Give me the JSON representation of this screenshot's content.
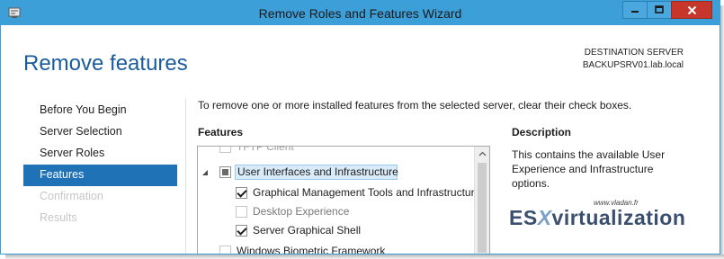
{
  "window": {
    "title": "Remove Roles and Features Wizard"
  },
  "header": {
    "title": "Remove features",
    "destination_label": "DESTINATION SERVER",
    "destination_server": "BACKUPSRV01.lab.local"
  },
  "nav": {
    "items": [
      {
        "label": "Before You Begin",
        "state": "normal"
      },
      {
        "label": "Server Selection",
        "state": "normal"
      },
      {
        "label": "Server Roles",
        "state": "normal"
      },
      {
        "label": "Features",
        "state": "active"
      },
      {
        "label": "Confirmation",
        "state": "disabled"
      },
      {
        "label": "Results",
        "state": "disabled"
      }
    ]
  },
  "main": {
    "intro": "To remove one or more installed features from the selected server, clear their check boxes.",
    "features_heading": "Features",
    "description_heading": "Description",
    "description_text": "This contains the available User Experience and Infrastructure options.",
    "tree": [
      {
        "label": "TFTP Client",
        "checked": false,
        "indent": 1
      },
      {
        "label": "User Interfaces and Infrastructure",
        "checked": "partial",
        "expanded": true,
        "selected": true,
        "indent": 0
      },
      {
        "label": "Graphical Management Tools and Infrastructure",
        "checked": true,
        "indent": 2
      },
      {
        "label": "Desktop Experience",
        "checked": false,
        "indent": 2
      },
      {
        "label": "Server Graphical Shell",
        "checked": true,
        "indent": 2
      },
      {
        "label": "Windows Biometric Framework",
        "checked": false,
        "indent": 1
      }
    ]
  },
  "watermark": {
    "url": "www.vladan.fr",
    "logo_prefix": "ES",
    "logo_x": "X",
    "logo_suffix": "virtualization"
  },
  "colors": {
    "titlebar": "#3d9fd8",
    "accent_title": "#1a5b9e",
    "nav_active": "#1e72b5",
    "close_button": "#c7362b"
  },
  "icons": {
    "app": "server-manager-icon",
    "minimize": "minimize-icon",
    "maximize": "maximize-icon",
    "close": "close-icon",
    "expander": "triangle-expanded-icon",
    "scroll_up": "chevron-up-icon"
  }
}
